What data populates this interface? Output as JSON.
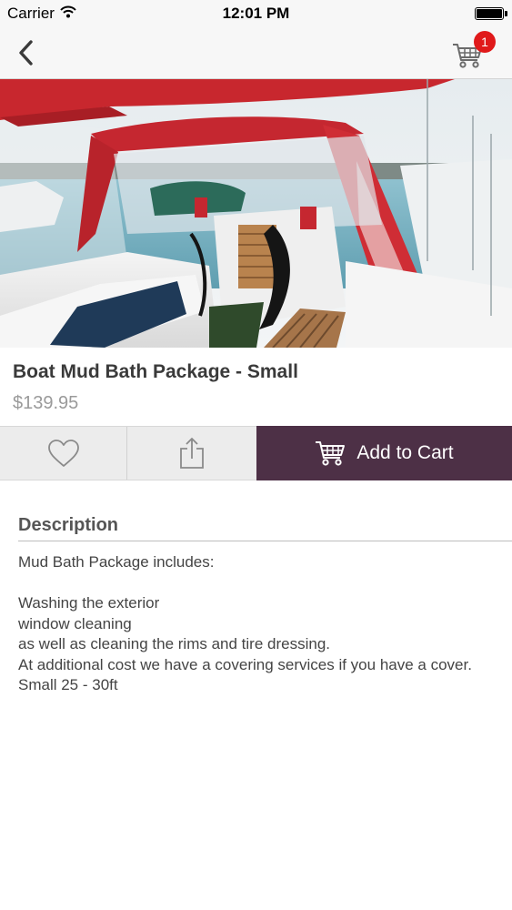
{
  "status_bar": {
    "carrier": "Carrier",
    "time": "12:01 PM"
  },
  "nav": {
    "back_icon": "chevron-left-icon",
    "cart_icon": "shopping-cart-icon",
    "cart_count": "1"
  },
  "product": {
    "title": "Boat Mud Bath Package - Small",
    "price": "$139.95"
  },
  "actions": {
    "wishlist_icon": "heart-icon",
    "share_icon": "share-icon",
    "add_to_cart_label": "Add to Cart"
  },
  "description": {
    "heading": "Description",
    "lines": [
      "Mud Bath Package includes:",
      "",
      "Washing the exterior",
      "window cleaning",
      "as well as cleaning the rims and tire dressing.",
      "At additional cost we have a covering services if you have a cover.",
      "Small 25 - 30ft"
    ]
  },
  "colors": {
    "accent": "#4d3046",
    "badge": "#e0191a",
    "price": "#9a9a9a"
  }
}
